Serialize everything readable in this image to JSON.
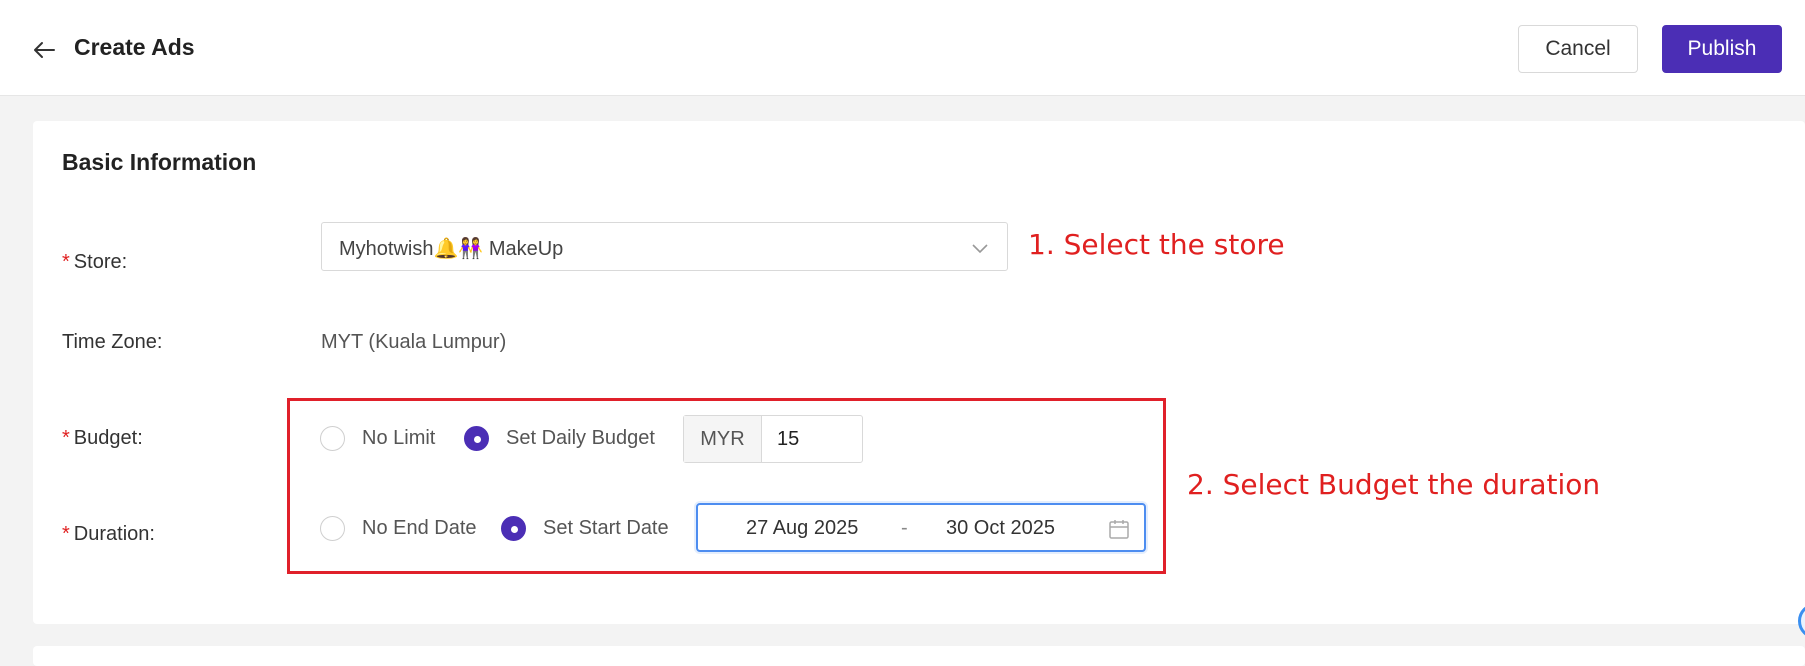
{
  "header": {
    "title": "Create Ads",
    "cancel_label": "Cancel",
    "publish_label": "Publish",
    "back_icon": "arrow-left-icon"
  },
  "section": {
    "title": "Basic Information"
  },
  "form": {
    "store": {
      "label": "Store",
      "value": "Myhotwish🔔👭 MakeUp"
    },
    "timezone": {
      "label": "Time Zone",
      "value": "MYT (Kuala Lumpur)"
    },
    "budget": {
      "label": "Budget",
      "options": [
        "No Limit",
        "Set Daily Budget"
      ],
      "selected": "Set Daily Budget",
      "currency": "MYR",
      "amount": "15"
    },
    "duration": {
      "label": "Duration",
      "options": [
        "No End Date",
        "Set Start Date"
      ],
      "selected": "Set Start Date",
      "start_date": "27 Aug 2025",
      "separator": "-",
      "end_date": "30 Oct 2025"
    }
  },
  "annotations": {
    "step1": "1. Select the store",
    "step2": "2. Select Budget the duration"
  },
  "colors": {
    "primary": "#4b2eb5",
    "annotation": "#e02020",
    "focus": "#4d8df0"
  }
}
